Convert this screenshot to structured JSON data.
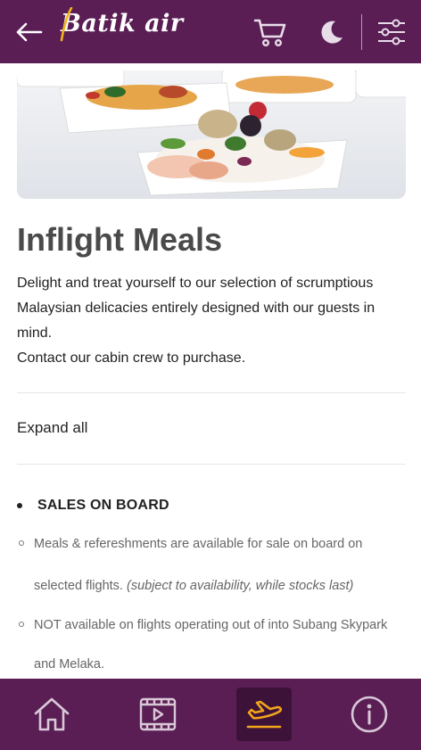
{
  "header": {
    "logo_text": "Batik air",
    "icons": [
      "back-arrow-icon",
      "cart-icon",
      "moon-icon",
      "sliders-icon"
    ],
    "background_color": "#5a1e55",
    "logo_accent_color": "#f2b21b"
  },
  "hero": {
    "image_description": "meal-tray-photo"
  },
  "main": {
    "title": "Inflight Meals",
    "intro_line1": "Delight and treat yourself to our selection of scrumptious",
    "intro_line2": "Malaysian delicacies entirely designed with our guests in",
    "intro_line3": "mind.",
    "intro_line4": "Contact our cabin crew to purchase.",
    "expand_all_label": "Expand all",
    "section": {
      "title": "SALES ON BOARD",
      "items": [
        {
          "line1": "Meals & refereshments are available for sale on board on",
          "line2": "selected flights. ",
          "line2_note": "(subject to availability, while stocks last)"
        },
        {
          "line1": "NOT available on flights operating out of into Subang Skypark",
          "line2": "and Melaka."
        }
      ]
    }
  },
  "bottom_nav": {
    "items": [
      {
        "name": "home",
        "icon": "home-icon",
        "active": false
      },
      {
        "name": "entertainment",
        "icon": "film-icon",
        "active": false
      },
      {
        "name": "flight",
        "icon": "airplane-takeoff-icon",
        "active": true
      },
      {
        "name": "info",
        "icon": "info-icon",
        "active": false
      }
    ],
    "background_color": "#5a1e55",
    "active_icon_color": "#f2a51b"
  }
}
